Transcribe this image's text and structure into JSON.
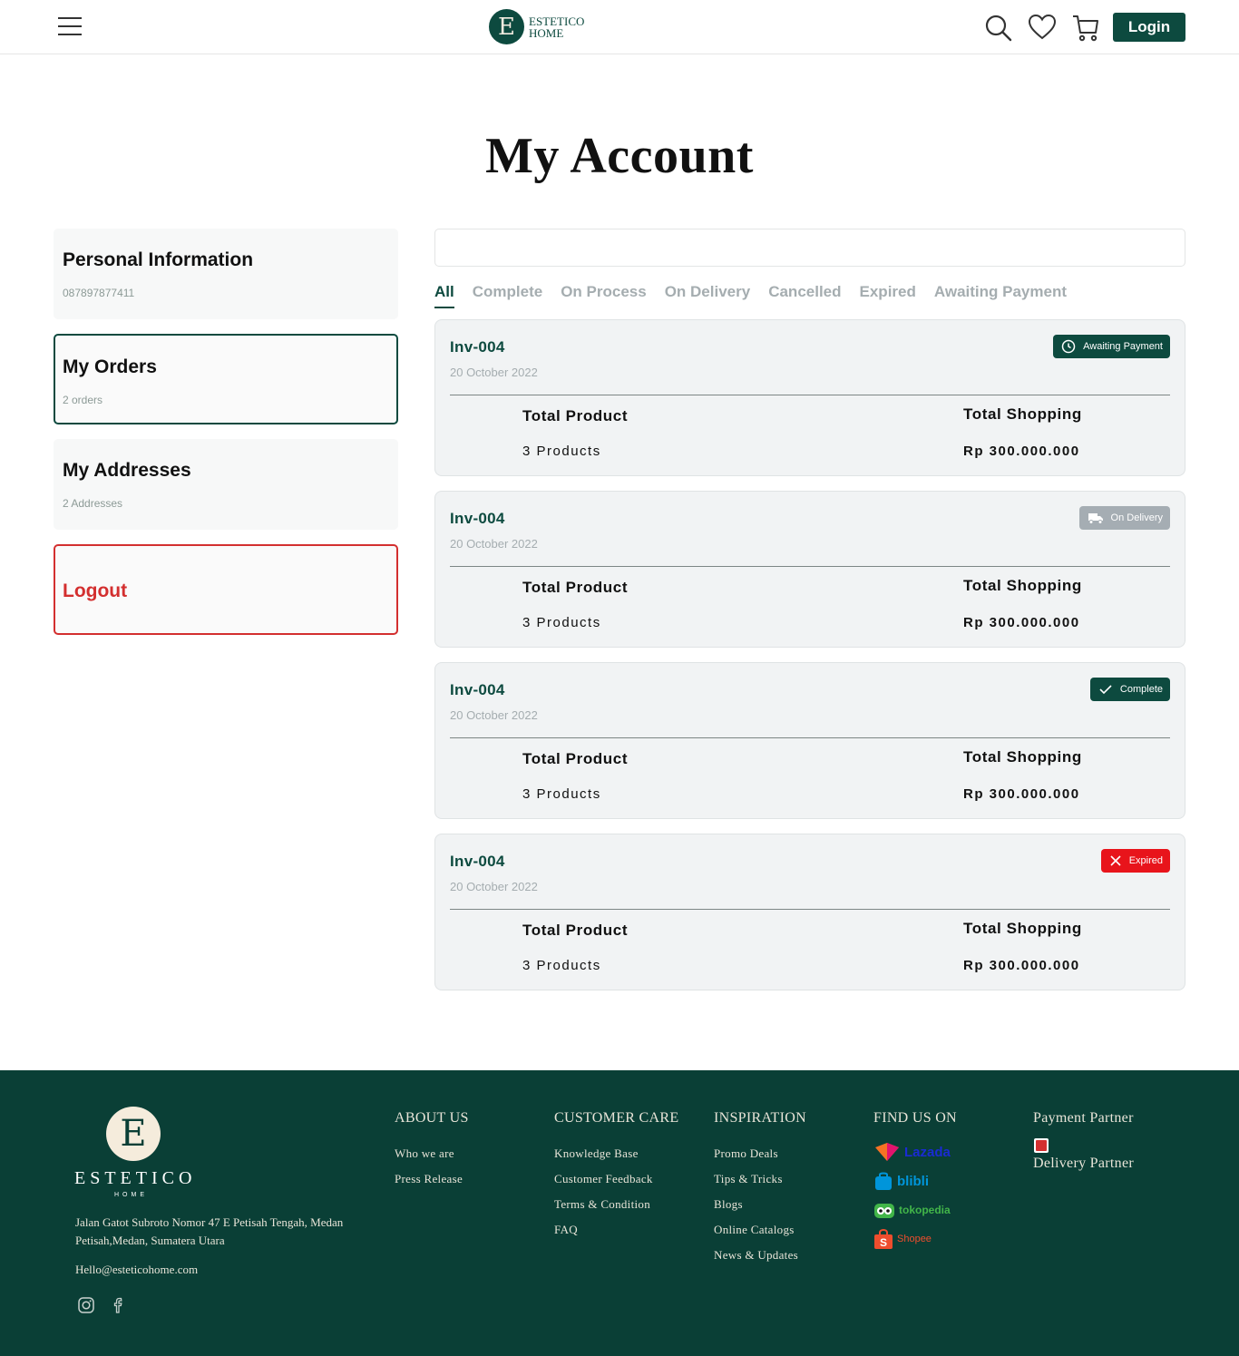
{
  "header": {
    "brand_line1": "ESTETICO",
    "brand_line2": "HOME",
    "logo_letter": "E",
    "login_label": "Login"
  },
  "page": {
    "title": "My Account"
  },
  "sidebar": {
    "personal": {
      "title": "Personal Information",
      "sub": "087897877411"
    },
    "orders": {
      "title": "My Orders",
      "sub": "2 orders"
    },
    "addresses": {
      "title": "My Addresses",
      "sub": "2 Addresses"
    },
    "logout": {
      "title": "Logout"
    }
  },
  "search": {
    "value": ""
  },
  "tabs": [
    "All",
    "Complete",
    "On Process",
    "On Delivery",
    "Cancelled",
    "Expired",
    "Awaiting Payment"
  ],
  "orders": [
    {
      "invoice": "Inv-004",
      "date": "20 October 2022",
      "total_product_label": "Total Product",
      "total_product_value": "3 Products",
      "total_shopping_label": "Total Shopping",
      "total_shopping_value": "Rp 300.000.000",
      "status": "Awaiting Payment",
      "status_icon": "clock-icon",
      "status_color": "#0d4a3f"
    },
    {
      "invoice": "Inv-004",
      "date": "20 October 2022",
      "total_product_label": "Total Product",
      "total_product_value": "3 Products",
      "total_shopping_label": "Total Shopping",
      "total_shopping_value": "Rp 300.000.000",
      "status": "On Delivery",
      "status_icon": "truck-icon",
      "status_color": "#a5adb3"
    },
    {
      "invoice": "Inv-004",
      "date": "20 October 2022",
      "total_product_label": "Total Product",
      "total_product_value": "3 Products",
      "total_shopping_label": "Total Shopping",
      "total_shopping_value": "Rp 300.000.000",
      "status": "Complete",
      "status_icon": "check-icon",
      "status_color": "#0d4a3f"
    },
    {
      "invoice": "Inv-004",
      "date": "20 October 2022",
      "total_product_label": "Total Product",
      "total_product_value": "3 Products",
      "total_shopping_label": "Total Shopping",
      "total_shopping_value": "Rp 300.000.000",
      "status": "Expired",
      "status_icon": "x-icon",
      "status_color": "#e8141b"
    }
  ],
  "footer": {
    "logo_letter": "E",
    "brand": "ESTETICO",
    "brand_sub": "HOME",
    "address": "Jalan Gatot Subroto Nomor 47 E Petisah Tengah, Medan Petisah,Medan, Sumatera Utara",
    "email": "Hello@esteticohome.com",
    "about": {
      "heading": "ABOUT US",
      "links": [
        "Who we are",
        "Press Release"
      ]
    },
    "care": {
      "heading": "CUSTOMER CARE",
      "links": [
        "Knowledge Base",
        "Customer Feedback",
        "Terms & Condition",
        "FAQ"
      ]
    },
    "inspiration": {
      "heading": "INSPIRATION",
      "links": [
        "Promo Deals",
        "Tips & Tricks",
        "Blogs",
        "Online Catalogs",
        "News & Updates"
      ]
    },
    "find": {
      "heading": "FIND US ON",
      "marketplaces": [
        "Lazada",
        "blibli",
        "tokopedia",
        "Shopee"
      ]
    },
    "payment": {
      "heading": "Payment Partner",
      "delivery_heading": "Delivery Partner"
    }
  },
  "colors": {
    "brand": "#0d4a3f",
    "footer_bg": "#0a3f36",
    "logout": "#d32f2f"
  }
}
